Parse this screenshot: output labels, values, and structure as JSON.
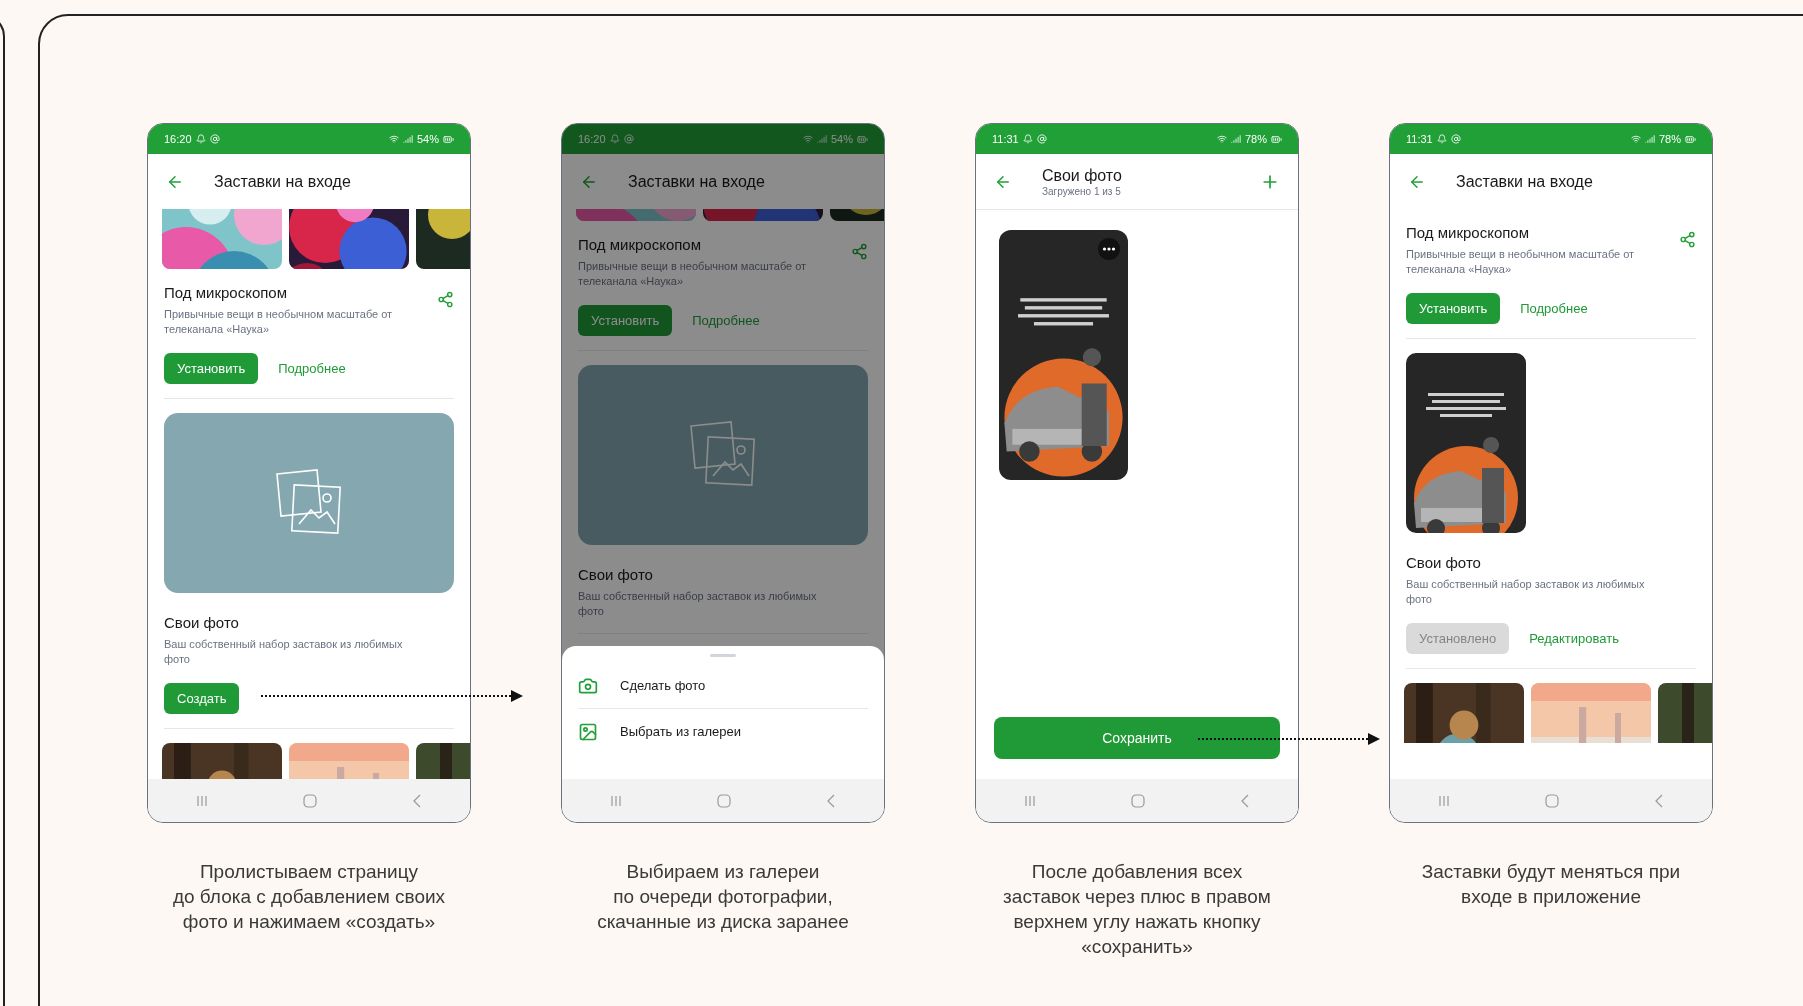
{
  "steps": [
    {
      "screen": {
        "kind": "catalog",
        "dimmed": false,
        "status": {
          "time": "16:20",
          "battery": "54%"
        },
        "title": "Заставки на входе",
        "sections": [
          {
            "kind": "strip"
          },
          {
            "kind": "set",
            "title": "Под микроскопом",
            "description": "Привычные вещи в необычном масштабе от телеканала «Наука»",
            "shareable": true,
            "buttons": [
              {
                "kind": "filled",
                "label": "Установить",
                "disabled": false
              },
              {
                "kind": "link",
                "label": "Подробнее"
              }
            ]
          },
          {
            "kind": "set",
            "preview": {
              "kind": "placeholder"
            },
            "title": "Свои фото",
            "description": "Ваш собственный набор заставок из любимых фото",
            "shareable": false,
            "buttons": [
              {
                "kind": "filled",
                "label": "Создать",
                "disabled": false
              }
            ]
          },
          {
            "kind": "strip"
          }
        ]
      },
      "arrow": true,
      "caption": "Пролистываем страницу\nдо блока с добавлением своих\nфото и нажимаем «создать»"
    },
    {
      "screen": {
        "kind": "catalog",
        "dimmed": true,
        "status": {
          "time": "16:20",
          "battery": "54%"
        },
        "title": "Заставки на входе",
        "sections": [
          {
            "kind": "edge"
          },
          {
            "kind": "set",
            "title": "Под микроскопом",
            "description": "Привычные вещи в необычном масштабе от телеканала «Наука»",
            "shareable": true,
            "buttons": [
              {
                "kind": "filled",
                "label": "Установить",
                "disabled": false
              },
              {
                "kind": "link",
                "label": "Подробнее"
              }
            ]
          },
          {
            "kind": "set",
            "preview": {
              "kind": "placeholder"
            },
            "title": "Свои фото",
            "description": "Ваш собственный набор заставок из любимых фото",
            "shareable": false
          }
        ],
        "sheet": {
          "items": [
            {
              "kind": "camera",
              "label": "Сделать фото"
            },
            {
              "kind": "gallery",
              "label": "Выбрать из галереи"
            }
          ]
        }
      },
      "arrow": false,
      "caption": "Выбираем из галереи\nпо очереди фотографии,\nскачанные из диска заранее"
    },
    {
      "screen": {
        "kind": "editor",
        "status": {
          "time": "11:31",
          "battery": "78%"
        },
        "title": "Свои фото",
        "subtitle": "Загружено 1 из 5",
        "uploads": [
          {
            "kind": "picture"
          }
        ],
        "save": "Сохранить"
      },
      "arrow": true,
      "caption": "После добавления всех\nзаставок через плюс в правом\nверхнем углу нажать кнопку\n«сохранить»"
    },
    {
      "screen": {
        "kind": "catalog",
        "dimmed": false,
        "status": {
          "time": "11:31",
          "battery": "78%"
        },
        "title": "Заставки на входе",
        "sections": [
          {
            "kind": "set",
            "title": "Под микроскопом",
            "description": "Привычные вещи в необычном масштабе от телеканала «Наука»",
            "shareable": true,
            "buttons": [
              {
                "kind": "filled",
                "label": "Установить",
                "disabled": false
              },
              {
                "kind": "link",
                "label": "Подробнее"
              }
            ]
          },
          {
            "kind": "set",
            "preview": {
              "kind": "picture"
            },
            "title": "Свои фото",
            "description": "Ваш собственный набор заставок из любимых фото",
            "shareable": false,
            "buttons": [
              {
                "kind": "filled",
                "label": "Установлено",
                "disabled": true
              },
              {
                "kind": "link",
                "label": "Редактировать"
              }
            ]
          },
          {
            "kind": "strip"
          }
        ]
      },
      "arrow": false,
      "caption": "Заставки будут меняться при\nвходе в приложение"
    }
  ]
}
